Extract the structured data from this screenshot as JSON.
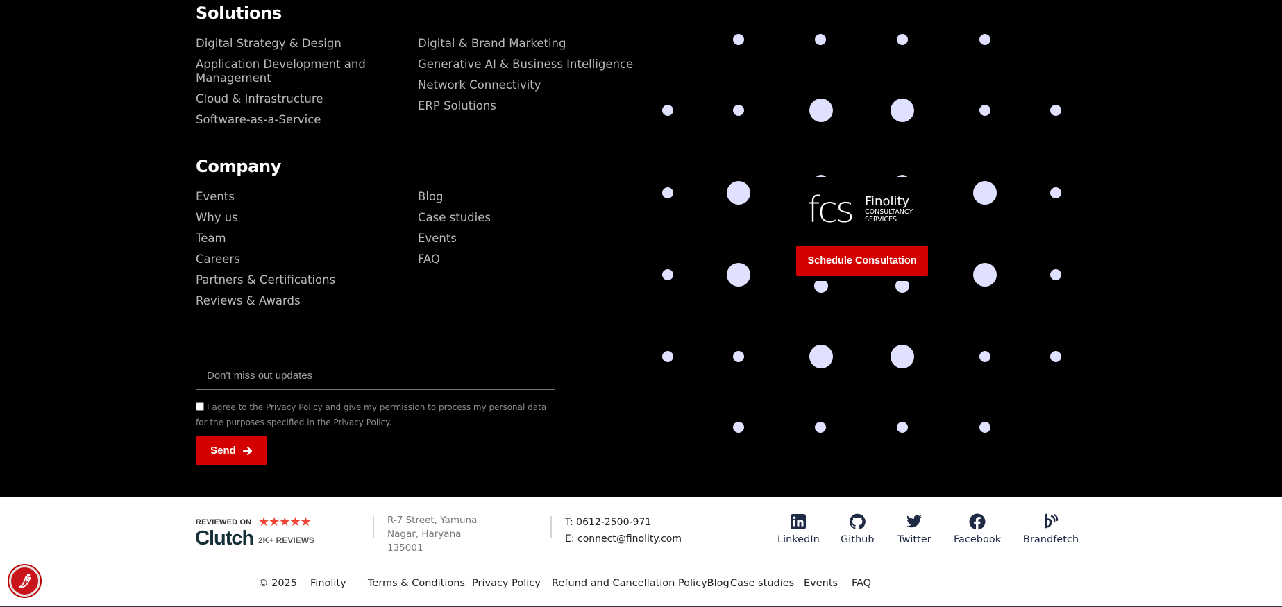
{
  "solutions": {
    "title": "Solutions",
    "col1": [
      "Digital Strategy & Design",
      "Application Development and Management",
      "Cloud & Infrastructure",
      "Software-as-a-Service"
    ],
    "col2": [
      "Digital & Brand Marketing",
      "Generative AI & Business Intelligence",
      "Network Connectivity",
      "ERP Solutions"
    ]
  },
  "company": {
    "title": "Company",
    "col1": [
      "Events",
      "Why us",
      "Team",
      "Careers",
      "Partners & Certifications",
      "Reviews & Awards"
    ],
    "col2": [
      "Blog",
      "Case studies",
      "Events",
      "FAQ"
    ]
  },
  "newsletter": {
    "placeholder": "Don't miss out updates",
    "consent": "I agree to the Privacy Policy and give my permission to process my personal data for the purposes specified in the Privacy Policy.",
    "consent_checked": false,
    "send_label": "Send"
  },
  "brand_card": {
    "logo_mark": "fcs",
    "name": "Finolity",
    "tagline_1": "CONSULTANCY",
    "tagline_2": "SERVICES",
    "cta": "Schedule Consultation"
  },
  "clutch": {
    "reviewed_on": "REVIEWED ON",
    "stars": "★★★★★",
    "logo": "Clutch",
    "reviews": "2K+ REVIEWS"
  },
  "address": "R-7 Street, Yamuna Nagar, Haryana 135001",
  "contact": {
    "phone": "T: 0612-2500-971",
    "email": "E: connect@finolity.com"
  },
  "social": [
    {
      "label": "LinkedIn",
      "icon": "linkedin-icon"
    },
    {
      "label": "Github",
      "icon": "github-icon"
    },
    {
      "label": "Twitter",
      "icon": "twitter-icon"
    },
    {
      "label": "Facebook",
      "icon": "facebook-icon"
    },
    {
      "label": "Brandfetch",
      "icon": "brandfetch-icon"
    }
  ],
  "bottom_bar": {
    "copyright": "© 2025",
    "company": "Finolity",
    "terms": "Terms & Conditions",
    "privacy": "Privacy Policy",
    "refund": "Refund and Cancellation PolicyBlog",
    "case_studies": "Case studies",
    "events": "Events",
    "faq": "FAQ"
  },
  "colors": {
    "background_dark": "#000000",
    "accent_red": "#d40000",
    "dot_color": "#dfe1ff",
    "link_gray": "#b9b9b9"
  }
}
